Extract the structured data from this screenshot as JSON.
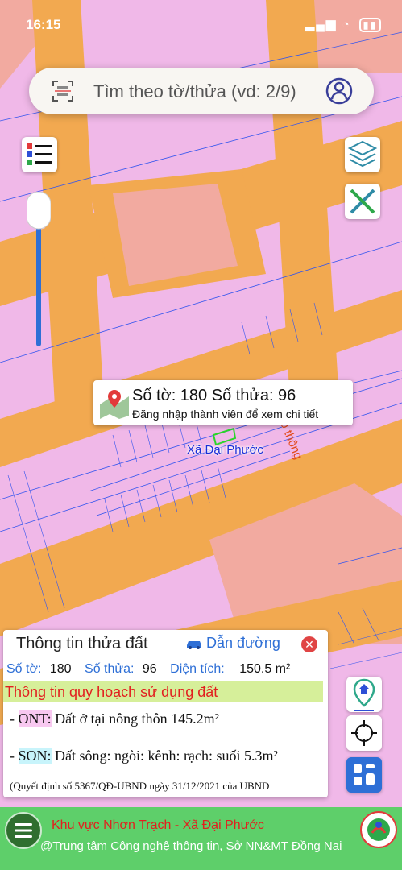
{
  "status": {
    "time": "16:15"
  },
  "search": {
    "placeholder": "Tìm theo tờ/thửa (vd: 2/9)"
  },
  "popup": {
    "title": "Số tờ: 180 Số thửa: 96",
    "subtitle": "Đăng nhập thành viên để xem chi tiết"
  },
  "map": {
    "commune_label": "Xã Đại Phước",
    "road_label": "o thông"
  },
  "panel": {
    "title": "Thông tin thửa đất",
    "direction_label": "Dẫn đường",
    "sheet_label": "Số tờ:",
    "sheet_value": "180",
    "parcel_label": "Số thửa:",
    "parcel_value": "96",
    "area_label": "Diện tích:",
    "area_value": "150.5 m²",
    "plan_header": "Thông tin quy hoạch sử dụng đất",
    "plan_items": [
      {
        "prefix": "- ",
        "code": "ONT:",
        "desc": " Đất ở tại nông thôn 145.2m²"
      },
      {
        "prefix": "- ",
        "code": "SON:",
        "desc": " Đất sông: ngòi: kênh: rạch: suối 5.3m²"
      }
    ],
    "decision": "(Quyết định số 5367/QĐ-UBND ngày 31/12/2021 của UBND"
  },
  "bottom": {
    "title": "Khu vực Nhơn Trạch - Xã Đại Phước",
    "subtitle": "@Trung tâm Công nghệ thông tin, Sở NN&MT Đồng Nai"
  },
  "colors": {
    "land_pink": "#f0b8e8",
    "road_orange": "#f2a950",
    "plot_salmon": "#f2aaa0",
    "parcel_line": "#3355ee",
    "accent_blue": "#2e6fd6",
    "bottom_green": "#5ecf6a"
  }
}
